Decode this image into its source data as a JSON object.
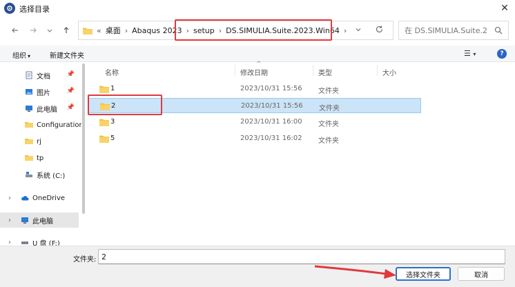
{
  "window": {
    "title": "选择目录",
    "close_glyph": "✕"
  },
  "address": {
    "crumbs": [
      "桌面",
      "Abaqus 2023",
      "setup",
      "DS.SIMULIA.Suite.2023.Win64"
    ],
    "overflow": "«",
    "separator": "›"
  },
  "search": {
    "placeholder": "在 DS.SIMULIA.Suite.202..."
  },
  "toolbar": {
    "organize_label": "组织",
    "new_folder_label": "新建文件夹",
    "view_glyph": "☰",
    "help_glyph": "?"
  },
  "sidebar": {
    "items": [
      {
        "label": "文档",
        "icon": "document-icon",
        "pinned": true
      },
      {
        "label": "图片",
        "icon": "picture-icon",
        "pinned": true
      },
      {
        "label": "此电脑",
        "icon": "computer-icon",
        "pinned": true
      },
      {
        "label": "Configuration",
        "icon": "folder-icon",
        "pinned": false
      },
      {
        "label": "rj",
        "icon": "folder-icon",
        "pinned": false
      },
      {
        "label": "tp",
        "icon": "folder-icon",
        "pinned": false
      },
      {
        "label": "系统 (C:)",
        "icon": "drive-icon",
        "pinned": false
      },
      {
        "label": "OneDrive",
        "icon": "cloud-icon",
        "pinned": false
      },
      {
        "label": "此电脑",
        "icon": "computer-icon",
        "pinned": false
      },
      {
        "label": "U 盘 (F:)",
        "icon": "usb-drive-icon",
        "pinned": false
      }
    ]
  },
  "columns": {
    "name": "名称",
    "modified": "修改日期",
    "type": "类型",
    "size": "大小"
  },
  "files": [
    {
      "name": "1",
      "modified": "2023/10/31 15:56",
      "type": "文件夹"
    },
    {
      "name": "2",
      "modified": "2023/10/31 15:56",
      "type": "文件夹"
    },
    {
      "name": "3",
      "modified": "2023/10/31 16:00",
      "type": "文件夹"
    },
    {
      "name": "5",
      "modified": "2023/10/31 16:02",
      "type": "文件夹"
    }
  ],
  "footer": {
    "folder_label": "文件夹:",
    "folder_value": "2",
    "select_button": "选择文件夹",
    "cancel_button": "取消"
  },
  "colors": {
    "highlight_red": "#e0393e",
    "selection_blue": "#cce4f7",
    "folder_yellow": "#f4c542",
    "accent_blue": "#2a6fcf"
  }
}
